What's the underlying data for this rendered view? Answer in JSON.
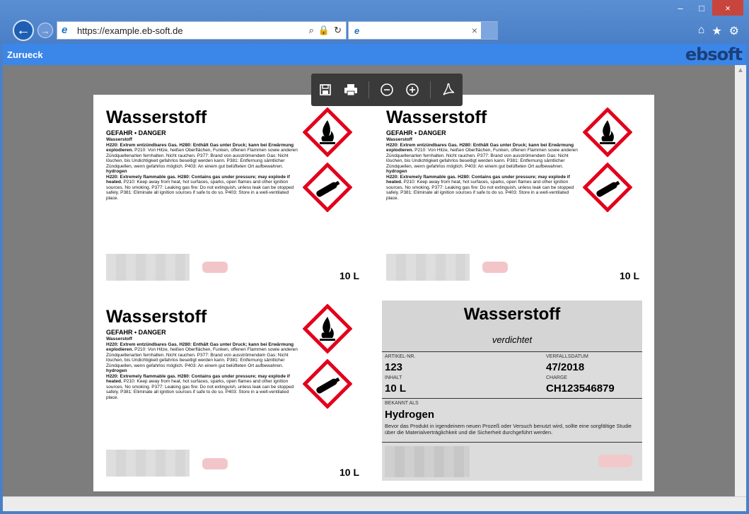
{
  "browser": {
    "url": "https://example.eb-soft.de",
    "tab_title": "",
    "tab_close": "×",
    "back_glyph": "←",
    "forward_glyph": "→",
    "minimize_glyph": "–",
    "maximize_glyph": "□",
    "close_glyph": "×",
    "home_glyph": "⌂",
    "favorites_glyph": "★",
    "settings_glyph": "⚙",
    "search_glyph": "⌕",
    "lock_glyph": "🔒",
    "refresh_glyph": "↻"
  },
  "app": {
    "back_label": "Zurueck",
    "logo": "ebsoft"
  },
  "labels": [
    {
      "title": "Wasserstoff",
      "signal": "GEFAHR • DANGER",
      "lang_de": "Wasserstoff",
      "text_de_bold": "H220: Extrem entzündbares Gas. H280: Enthält Gas unter Druck; kann bei Erwärmung explodieren.",
      "text_de": " P210: Von Hitze, heißen Oberflächen, Funken, offenen Flammen sowie anderen Zündquellenarten fernhalten. Nicht rauchen. P377: Brand von ausströmendem Gas: Nicht löschen, bis Undichtigkeit gefahrlos beseitigt werden kann. P381: Entfernung sämtlicher Zündquellen, wenn gefahrlos möglich. P403: An einem gut belüfteten Ort aufbewahren.",
      "lang_en": "hydrogen",
      "text_en_bold": "H220: Extremely flammable gas. H280: Contains gas under pressure; may explode if heated.",
      "text_en": " P210: Keep away from heat, hot surfaces, sparks, open flames and other ignition sources. No smoking. P377: Leaking gas fire: Do not extinguish, unless leak can be stopped safely. P381: Eliminate all ignition sources if safe to do so. P403: Store in a well-ventilated place.",
      "volume": "10 L"
    },
    {
      "title": "Wasserstoff",
      "signal": "GEFAHR • DANGER",
      "lang_de": "Wasserstoff",
      "text_de_bold": "H220: Extrem entzündbares Gas. H280: Enthält Gas unter Druck; kann bei Erwärmung explodieren.",
      "text_de": " P210: Von Hitze, heißen Oberflächen, Funken, offenen Flammen sowie anderen Zündquellenarten fernhalten. Nicht rauchen. P377: Brand von ausströmendem Gas: Nicht löschen, bis Undichtigkeit gefahrlos beseitigt werden kann. P381: Entfernung sämtlicher Zündquellen, wenn gefahrlos möglich. P403: An einem gut belüfteten Ort aufbewahren.",
      "lang_en": "hydrogen",
      "text_en_bold": "H220: Extremely flammable gas. H280: Contains gas under pressure; may explode if heated.",
      "text_en": " P210: Keep away from heat, hot surfaces, sparks, open flames and other ignition sources. No smoking. P377: Leaking gas fire: Do not extinguish, unless leak can be stopped safely. P381: Eliminate all ignition sources if safe to do so. P403: Store in a well-ventilated place.",
      "volume": "10 L"
    },
    {
      "title": "Wasserstoff",
      "signal": "GEFAHR • DANGER",
      "lang_de": "Wasserstoff",
      "text_de_bold": "H220: Extrem entzündbares Gas. H280: Enthält Gas unter Druck; kann bei Erwärmung explodieren.",
      "text_de": " P210: Von Hitze, heißen Oberflächen, Funken, offenen Flammen sowie anderen Zündquellenarten fernhalten. Nicht rauchen. P377: Brand von ausströmendem Gas: Nicht löschen, bis Undichtigkeit gefahrlos beseitigt werden kann. P381: Entfernung sämtlicher Zündquellen, wenn gefahrlos möglich. P403: An einem gut belüfteten Ort aufbewahren.",
      "lang_en": "hydrogen",
      "text_en_bold": "H220: Extremely flammable gas. H280: Contains gas under pressure; may explode if heated.",
      "text_en": " P210: Keep away from heat, hot surfaces, sparks, open flames and other ignition sources. No smoking. P377: Leaking gas fire: Do not extinguish, unless leak can be stopped safely. P381: Eliminate all ignition sources if safe to do so. P403: Store in a well-ventilated place.",
      "volume": "10 L"
    }
  ],
  "info_label": {
    "title": "Wasserstoff",
    "subtitle": "verdichtet",
    "artikel_caption": "ARTIKEL-NR.",
    "artikel_value": "123",
    "verfall_caption": "VERFALLSDATUM",
    "verfall_value": "47/2018",
    "inhalt_caption": "INHALT",
    "inhalt_value": "10 L",
    "charge_caption": "CHARGE",
    "charge_value": "CH123546879",
    "bekannt_caption": "BEKANNT ALS",
    "bekannt_value": "Hydrogen",
    "note": "Bevor das Produkt in irgendeinem neuen Prozeß oder Versuch benutzt wird, sollte eine sorgfältige Studie über die Materialverträglichkeit und die Sicherheit durchgeführt werden."
  },
  "colors": {
    "accent": "#3b86e9",
    "pictogram_red": "#e3001b",
    "toolbar_bg": "#3a3a3a"
  }
}
